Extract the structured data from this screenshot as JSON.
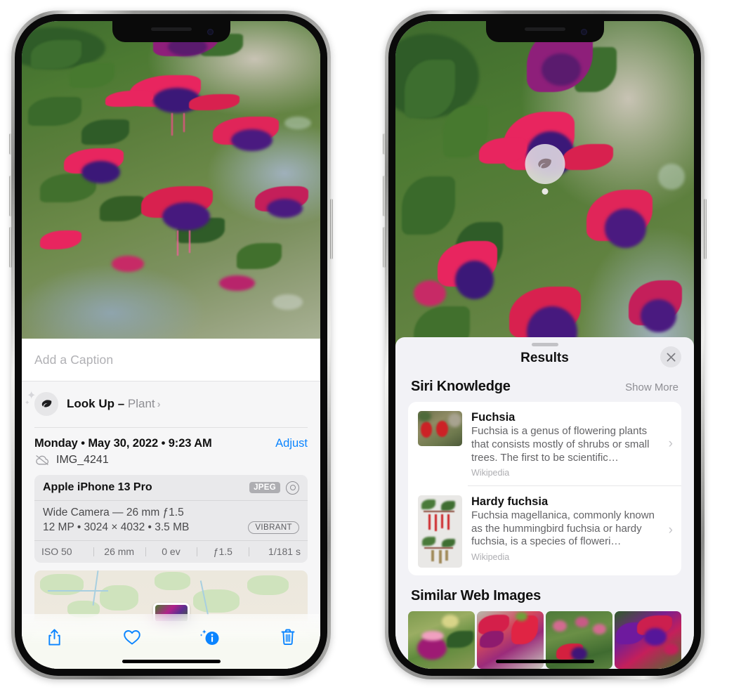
{
  "left_phone": {
    "caption_placeholder": "Add a Caption",
    "lookup": {
      "label": "Look Up",
      "dash": " – ",
      "subject": "Plant",
      "chevron": "›",
      "icon": "leaf-icon"
    },
    "date": "Monday • May 30, 2022 • 9:23 AM",
    "adjust_label": "Adjust",
    "filename": "IMG_4241",
    "camera": {
      "device": "Apple iPhone 13 Pro",
      "format_chip": "JPEG",
      "lens_line": "Wide Camera — 26 mm ƒ1.5",
      "spec_line": "12 MP • 3024 × 4032 • 3.5 MB",
      "style_chip": "VIBRANT",
      "exif": [
        "ISO 50",
        "26 mm",
        "0 ev",
        "ƒ1.5",
        "1/181 s"
      ]
    },
    "toolbar": {
      "share": "share-icon",
      "favorite": "heart-icon",
      "info": "info-icon",
      "delete": "trash-icon"
    }
  },
  "right_phone": {
    "sheet_title": "Results",
    "close_label": "✕",
    "siri": {
      "section_title": "Siri Knowledge",
      "show_more": "Show More",
      "items": [
        {
          "title": "Fuchsia",
          "desc": "Fuchsia is a genus of flowering plants that consists mostly of shrubs or small trees. The first to be scientific…",
          "source": "Wikipedia",
          "chevron": "›"
        },
        {
          "title": "Hardy fuchsia",
          "desc": "Fuchsia magellanica, commonly known as the hummingbird fuchsia or hardy fuchsia, is a species of floweri…",
          "source": "Wikipedia",
          "chevron": "›"
        }
      ]
    },
    "similar": {
      "section_title": "Similar Web Images",
      "count": 4
    },
    "visual_lookup_badge": "leaf-icon"
  },
  "colors": {
    "accent_blue": "#0a84ff",
    "sheet_bg": "#f2f2f6",
    "card_bg": "#ffffff",
    "secondary_text": "#8e8e93"
  }
}
